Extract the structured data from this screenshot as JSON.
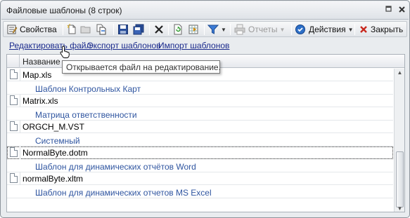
{
  "window": {
    "title": "Файловые шаблоны (8 строк)"
  },
  "toolbar": {
    "properties_label": "Свойства",
    "reports_label": "Отчеты",
    "actions_label": "Действия",
    "close_label": "Закрыть"
  },
  "links": {
    "edit_file": "Редактировать файл",
    "export_templates": "Экспорт шаблонов",
    "import_templates": "Импорт шаблонов"
  },
  "tooltip": {
    "text": "Открывается файл на редактирование."
  },
  "grid": {
    "column_name": "Название",
    "rows": [
      {
        "file": "Map.xls",
        "description": "Шаблон Контрольных Карт"
      },
      {
        "file": "Matrix.xls",
        "description": "Матрица ответственности"
      },
      {
        "file": "ORGCH_M.VST",
        "description": "Системный"
      },
      {
        "file": "NormalByte.dotm",
        "description": "Шаблон для динамических отчётов Word"
      },
      {
        "file": "normalByte.xltm",
        "description": "Шаблон для динамических отчетов MS Excel"
      }
    ]
  },
  "colors": {
    "link": "#1a2a8c",
    "description_text": "#2f55a0",
    "close_x": "#c8281e"
  }
}
